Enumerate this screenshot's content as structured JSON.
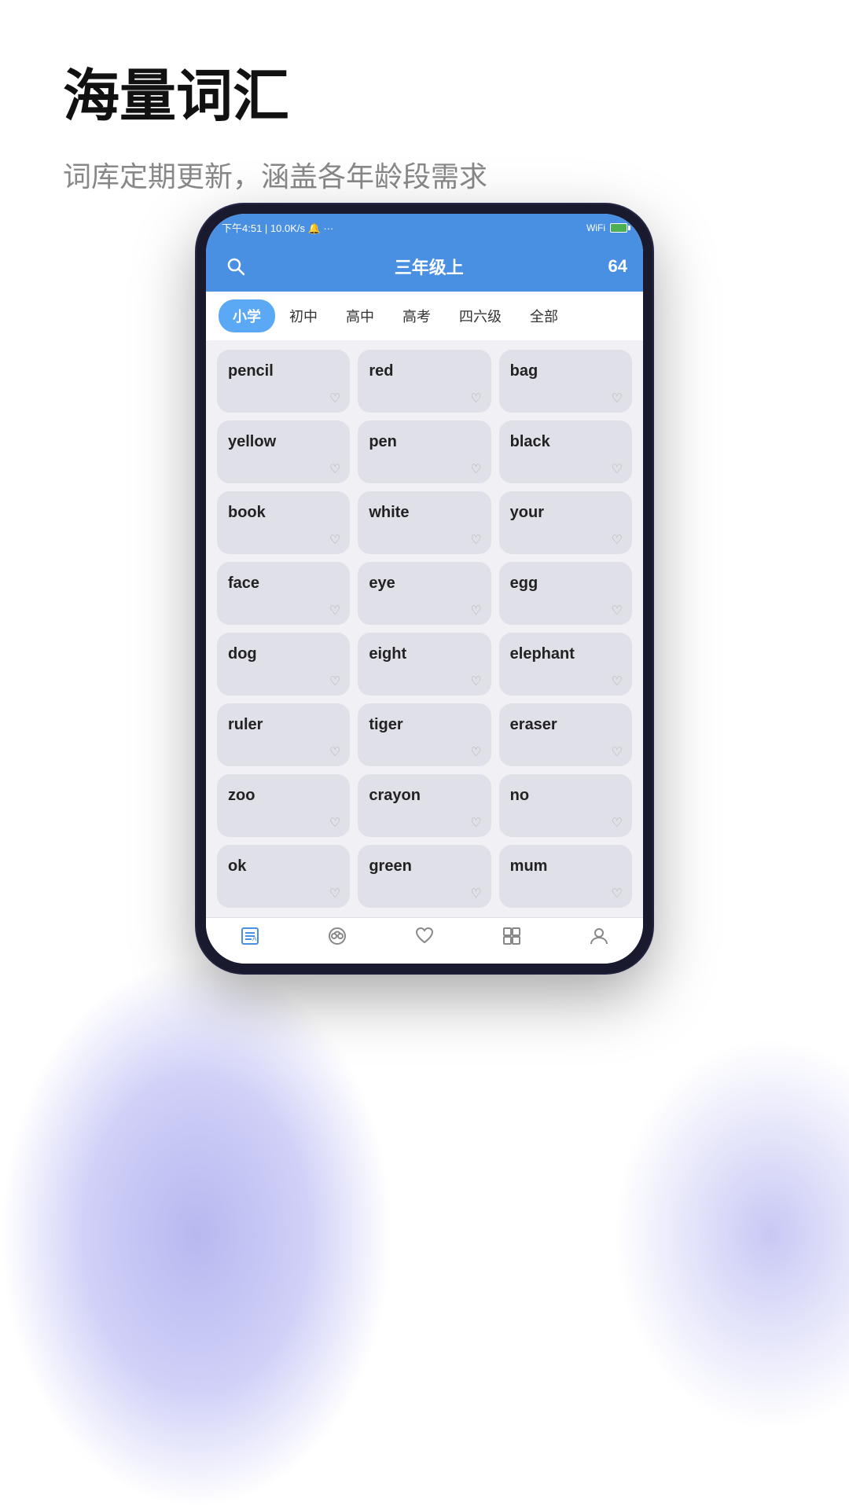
{
  "page": {
    "title": "海量词汇",
    "subtitle": "词库定期更新，涵盖各年龄段需求"
  },
  "statusBar": {
    "time": "下午4:51",
    "network": "10.0K/s",
    "icons": "🔔 ···"
  },
  "appHeader": {
    "title": "三年级上",
    "count": "64"
  },
  "tabs": [
    {
      "id": "xiaoxue",
      "label": "小学",
      "active": true
    },
    {
      "id": "chuzhong",
      "label": "初中",
      "active": false
    },
    {
      "id": "gaozhong",
      "label": "高中",
      "active": false
    },
    {
      "id": "gaokao",
      "label": "高考",
      "active": false
    },
    {
      "id": "sijiliuji",
      "label": "四六级",
      "active": false
    },
    {
      "id": "quanbu",
      "label": "全部",
      "active": false
    }
  ],
  "words": [
    "pencil",
    "red",
    "bag",
    "yellow",
    "pen",
    "black",
    "book",
    "white",
    "your",
    "face",
    "eye",
    "egg",
    "dog",
    "eight",
    "elephant",
    "ruler",
    "tiger",
    "eraser",
    "zoo",
    "crayon",
    "no",
    "ok",
    "green",
    "mum"
  ],
  "bottomNav": [
    {
      "id": "vocab",
      "icon": "📋",
      "active": true
    },
    {
      "id": "learn",
      "icon": "🎧",
      "active": false
    },
    {
      "id": "favorite",
      "icon": "♡",
      "active": false
    },
    {
      "id": "expand",
      "icon": "🔲",
      "active": false
    },
    {
      "id": "profile",
      "icon": "👤",
      "active": false
    }
  ]
}
